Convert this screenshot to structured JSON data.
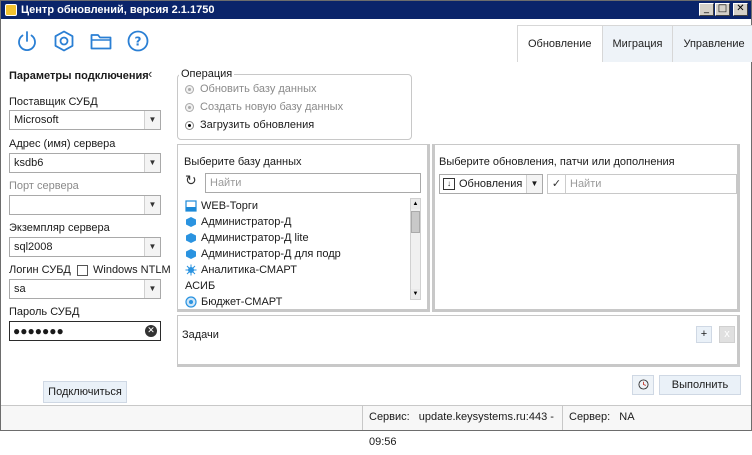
{
  "window": {
    "title": "Центр обновлений, версия 2.1.1750",
    "buttons": {
      "minimize": "_",
      "maximize": "□",
      "close": "✕"
    }
  },
  "toolbar": {
    "icons": [
      "power-icon",
      "gear-icon",
      "folder-icon",
      "help-icon"
    ],
    "help_glyph": "?"
  },
  "tabs": [
    {
      "label": "Обновление",
      "active": true
    },
    {
      "label": "Миграция",
      "active": false
    },
    {
      "label": "Управление",
      "active": false
    }
  ],
  "connection": {
    "title": "Параметры подключения",
    "collapse_glyph": "‹",
    "dbms_provider": {
      "label": "Поставщик СУБД",
      "value": "Microsoft"
    },
    "server_address": {
      "label": "Адрес (имя) сервера",
      "value": "ksdb6"
    },
    "server_port": {
      "label": "Порт сервера",
      "value": ""
    },
    "server_instance": {
      "label": "Экземпляр сервера",
      "value": "sql2008"
    },
    "login": {
      "label": "Логин СУБД",
      "value": "sa"
    },
    "windows_ntlm": {
      "label": "Windows NTLM",
      "checked": false
    },
    "password": {
      "label": "Пароль СУБД",
      "value": "●●●●●●●"
    },
    "connect_button": "Подключиться"
  },
  "operation": {
    "legend": "Операция",
    "options": [
      {
        "label": "Обновить базу данных",
        "selected": false,
        "enabled": false
      },
      {
        "label": "Создать новую базу данных",
        "selected": false,
        "enabled": false
      },
      {
        "label": "Загрузить обновления",
        "selected": true,
        "enabled": true
      }
    ]
  },
  "database": {
    "title": "Выберите базу данных",
    "search_placeholder": "Найти",
    "items": [
      {
        "label": "WEB-Торги",
        "icon": "web-icon"
      },
      {
        "label": "Администратор-Д",
        "icon": "app-icon"
      },
      {
        "label": "Администратор-Д lite",
        "icon": "app-icon"
      },
      {
        "label": "Администратор-Д для подр",
        "icon": "app-icon"
      },
      {
        "label": "Аналитика-СМАРТ",
        "icon": "analytics-icon"
      },
      {
        "label": "АСИБ",
        "icon": ""
      },
      {
        "label": "Бюджет-СМАРТ",
        "icon": "budget-icon"
      }
    ]
  },
  "updates": {
    "title": "Выберите обновления, патчи или дополнения",
    "type_value": "Обновления",
    "search_placeholder": "Найти"
  },
  "tasks": {
    "label": "Задачи",
    "add_glyph": "+",
    "remove_glyph": "x"
  },
  "run": {
    "label": "Выполнить"
  },
  "status": {
    "service_label": "Сервис:",
    "service_value": "update.keysystems.ru:443 - 09:56",
    "server_label": "Сервер:",
    "server_value": "NA"
  },
  "colors": {
    "accent": "#2a7fd4",
    "titlebar": "#0a246a"
  }
}
